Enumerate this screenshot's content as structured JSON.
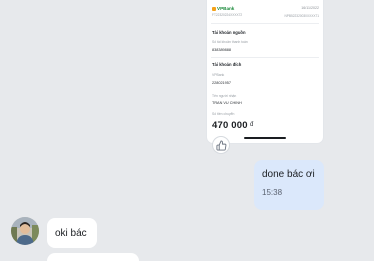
{
  "receipt": {
    "bank_name": "VPBank",
    "date": "16/11/2022",
    "ref_left": "FT22320224XXXX72",
    "ref_right": "NPB522320030XXXX71",
    "source_section": "Tài khoản nguồn",
    "source_account_label": "Số tài khoản thanh toán",
    "source_account_value": "838389888",
    "dest_section": "Tài khoản đích",
    "dest_bank_label": "VPBank",
    "dest_account_value": "228021957",
    "recipient_label": "Tên người nhận",
    "recipient_value": "TRAN VU CHINH",
    "amount_label": "Số tiền chuyển",
    "amount": "470 000",
    "currency": "đ"
  },
  "messages": {
    "outgoing_text": "done bác ơi",
    "outgoing_time": "15:38",
    "incoming_text": "oki bác"
  },
  "icons": {
    "reaction": "thumbs-up-icon",
    "avatar": "contact-avatar"
  },
  "colors": {
    "background": "#e7e9ec",
    "outgoing_bubble": "#dbe8fb",
    "incoming_bubble": "#ffffff",
    "bank_green": "#1b8a3b"
  }
}
